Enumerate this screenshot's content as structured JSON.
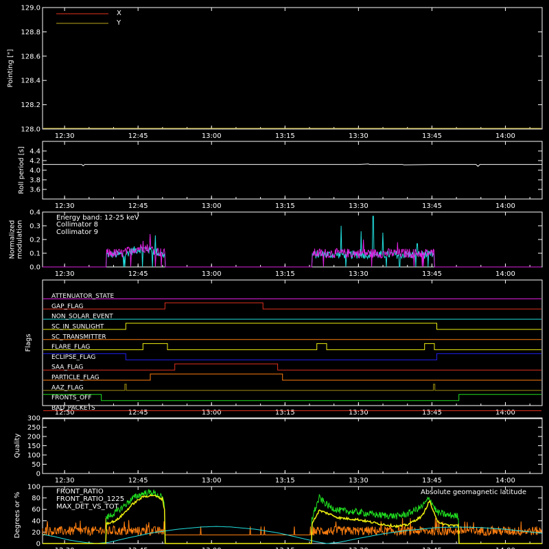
{
  "colors": {
    "background": "#000000",
    "axes": "#ffffff",
    "x": "#e8321e",
    "y": "#bfa81a",
    "white": "#ffffff",
    "cyan": "#22e0e0",
    "magenta": "#e020e0",
    "red": "#e0301e",
    "orange": "#ff7f10",
    "yellow": "#f0f010",
    "blue": "#2020f0",
    "olive": "#a09010",
    "green": "#20e020",
    "lime": "#40ff10"
  },
  "time_axis": {
    "start_min": 745.5,
    "end_min": 847.5,
    "tick_labels": [
      "12:30",
      "12:45",
      "13:00",
      "13:15",
      "13:30",
      "13:45",
      "14:00"
    ],
    "tick_values": [
      750,
      765,
      780,
      795,
      810,
      825,
      840
    ]
  },
  "chart_data": [
    {
      "id": "pointing",
      "type": "line",
      "ylabel": "Pointing [\"]",
      "ylim": [
        128.0,
        129.0
      ],
      "yticks": [
        "128.0",
        "128.2",
        "128.4",
        "128.6",
        "128.8",
        "129.0"
      ],
      "yticks_values": [
        128.0,
        128.2,
        128.4,
        128.6,
        128.8,
        129.0
      ],
      "legend_position": "top-left",
      "series": [
        {
          "name": "X",
          "color": "x",
          "x": [],
          "y": []
        },
        {
          "name": "Y",
          "color": "y",
          "x": [],
          "y": []
        }
      ]
    },
    {
      "id": "roll",
      "type": "line",
      "ylabel": "Roll period [s]",
      "ylim": [
        3.4,
        4.6
      ],
      "yticks": [
        "3.6",
        "3.8",
        "4.0",
        "4.2",
        "4.4"
      ],
      "yticks_values": [
        3.6,
        3.8,
        4.0,
        4.2,
        4.4
      ],
      "series": [
        {
          "color": "white",
          "x": [
            745.5,
            753.5,
            753.8,
            754.1,
            760,
            770,
            780,
            790,
            800,
            810,
            812,
            812.3,
            819,
            819.3,
            825,
            825.3,
            834,
            834.4,
            834.8,
            847.5
          ],
          "y": [
            4.12,
            4.12,
            4.09,
            4.12,
            4.12,
            4.12,
            4.12,
            4.12,
            4.12,
            4.12,
            4.13,
            4.12,
            4.12,
            4.11,
            4.12,
            4.12,
            4.12,
            4.08,
            4.12,
            4.12
          ]
        }
      ]
    },
    {
      "id": "modulation",
      "type": "line",
      "ylabel": [
        "Normalized",
        "modulation"
      ],
      "ylim": [
        0.0,
        0.4
      ],
      "yticks": [
        "0.0",
        "0.1",
        "0.2",
        "0.3",
        "0.4"
      ],
      "yticks_values": [
        0.0,
        0.1,
        0.2,
        0.3,
        0.4
      ],
      "annotation": "Energy band: 12-25 keV",
      "legend_position": "top-left",
      "active_intervals": [
        [
          758.5,
          770.5
        ],
        [
          800.5,
          825.5
        ]
      ],
      "series": [
        {
          "name": "Collimator 8",
          "color": "cyan",
          "baseline": 0.09,
          "spread": 0.03,
          "peaks": [
            [
              813,
              0.37
            ],
            [
              810.5,
              0.26
            ],
            [
              806.5,
              0.3
            ],
            [
              815,
              0.25
            ],
            [
              768.5,
              0.23
            ],
            [
              822,
              0.17
            ]
          ]
        },
        {
          "name": "Collimator 9",
          "color": "magenta",
          "baseline": 0.1,
          "spread": 0.035,
          "peaks": [
            [
              767.5,
              0.24
            ],
            [
              766,
              0.19
            ],
            [
              811,
              0.2
            ],
            [
              818,
              0.18
            ]
          ]
        }
      ]
    },
    {
      "id": "flags",
      "type": "line",
      "ylabel": "Flags",
      "flags": [
        {
          "name": "ATTENUATOR_STATE",
          "color": "magenta",
          "transitions": []
        },
        {
          "name": "GAP_FLAG",
          "color": "red",
          "transitions": [
            [
              770.5,
              1
            ],
            [
              790.5,
              0
            ]
          ]
        },
        {
          "name": "NON_SOLAR_EVENT",
          "color": "cyan",
          "transitions": []
        },
        {
          "name": "SC_IN_SUNLIGHT",
          "color": "yellow",
          "transitions": [
            [
              762.5,
              1
            ],
            [
              826,
              0
            ]
          ]
        },
        {
          "name": "SC_TRANSMITTER",
          "color": "orange",
          "transitions": []
        },
        {
          "name": "FLARE_FLAG",
          "color": "yellow",
          "transitions": [
            [
              766,
              1
            ],
            [
              771,
              0
            ],
            [
              801.5,
              1
            ],
            [
              803.5,
              0
            ],
            [
              823.5,
              1
            ],
            [
              825.5,
              0
            ]
          ]
        },
        {
          "name": "ECLIPSE_FLAG",
          "color": "blue",
          "transitions": [
            [
              762.5,
              0
            ],
            [
              826,
              1
            ]
          ]
        },
        {
          "name": "SAA_FLAG",
          "color": "red",
          "transitions": [
            [
              772.5,
              1
            ],
            [
              793.5,
              0
            ]
          ]
        },
        {
          "name": "PARTICLE_FLAG",
          "color": "orange",
          "transitions": [
            [
              767.5,
              1
            ],
            [
              794.5,
              0
            ]
          ]
        },
        {
          "name": "AAZ_FLAG",
          "color": "olive",
          "transitions": [
            [
              762.3,
              1
            ],
            [
              762.6,
              0
            ],
            [
              825.3,
              1
            ],
            [
              825.6,
              0
            ]
          ]
        },
        {
          "name": "FRONTS_OFF",
          "color": "green",
          "transitions": [
            [
              757.5,
              0
            ],
            [
              830.5,
              1
            ]
          ]
        },
        {
          "name": "BAD_PACKETS",
          "color": "red",
          "transitions": []
        }
      ],
      "initial_states": [
        0,
        0,
        0,
        0,
        0,
        0,
        1,
        0,
        0,
        0,
        1,
        0
      ]
    },
    {
      "id": "quality",
      "type": "line",
      "ylabel": "Quality",
      "ylim": [
        0,
        300
      ],
      "yticks": [
        "0",
        "50",
        "100",
        "150",
        "200",
        "250",
        "300"
      ],
      "yticks_values": [
        0,
        50,
        100,
        150,
        200,
        250,
        300
      ],
      "series": [
        {
          "color": "white",
          "x": [
            745.5,
            847.5
          ],
          "y": [
            300,
            300
          ]
        }
      ]
    },
    {
      "id": "ratio",
      "type": "line",
      "ylabel": "Degrees or %",
      "ylim": [
        0,
        100
      ],
      "yticks": [
        "0",
        "20",
        "40",
        "60",
        "80",
        "100"
      ],
      "yticks_values": [
        0,
        20,
        40,
        60,
        80,
        100
      ],
      "annotation": "Absolute geomagnetic latitude",
      "annotation_color": "cyan",
      "legend_position": "top-left",
      "active_intervals": [
        [
          758.5,
          770.5
        ],
        [
          800.5,
          830.5
        ]
      ],
      "series": [
        {
          "name": "FRONT_RATIO",
          "color": "yellow",
          "profile": [
            [
              758.5,
              35
            ],
            [
              760.5,
              40
            ],
            [
              762,
              52
            ],
            [
              764,
              70
            ],
            [
              766,
              82
            ],
            [
              768,
              85
            ],
            [
              770,
              78
            ],
            [
              770.5,
              55
            ],
            [
              800.5,
              35
            ],
            [
              802,
              58
            ],
            [
              804,
              52
            ],
            [
              806,
              45
            ],
            [
              810,
              42
            ],
            [
              814,
              35
            ],
            [
              818,
              30
            ],
            [
              820,
              33
            ],
            [
              823,
              48
            ],
            [
              824.5,
              75
            ],
            [
              826,
              40
            ],
            [
              828,
              32
            ],
            [
              830.5,
              32
            ]
          ]
        },
        {
          "name": "FRONT_RATIO_1225",
          "color": "green",
          "spread": 12,
          "profile": [
            [
              758.5,
              45
            ],
            [
              760.5,
              55
            ],
            [
              762,
              65
            ],
            [
              764,
              80
            ],
            [
              766,
              88
            ],
            [
              768,
              90
            ],
            [
              770,
              80
            ],
            [
              770.5,
              60
            ],
            [
              800.5,
              45
            ],
            [
              802,
              80
            ],
            [
              804,
              65
            ],
            [
              806,
              58
            ],
            [
              810,
              55
            ],
            [
              814,
              50
            ],
            [
              818,
              48
            ],
            [
              820,
              52
            ],
            [
              823,
              65
            ],
            [
              824.5,
              80
            ],
            [
              826,
              55
            ],
            [
              828,
              50
            ],
            [
              830.5,
              48
            ]
          ]
        },
        {
          "name": "MAX_DET_VS_TOT",
          "color": "orange",
          "baseline": 22,
          "spread": 8
        },
        {
          "name": "Absolute geomagnetic latitude",
          "color": "cyan",
          "profile": [
            [
              745.5,
              16
            ],
            [
              748,
              12
            ],
            [
              751,
              6
            ],
            [
              754,
              2
            ],
            [
              756.5,
              0
            ],
            [
              759,
              2
            ],
            [
              763,
              10
            ],
            [
              768,
              19
            ],
            [
              773,
              25
            ],
            [
              778,
              29
            ],
            [
              781,
              30
            ],
            [
              784,
              29
            ],
            [
              789,
              25
            ],
            [
              794,
              18
            ],
            [
              798,
              10
            ],
            [
              801.5,
              3
            ],
            [
              803.5,
              0
            ],
            [
              806,
              2
            ],
            [
              810,
              9
            ],
            [
              815,
              17
            ],
            [
              820,
              23
            ],
            [
              826,
              28
            ],
            [
              830,
              29
            ],
            [
              835,
              28
            ],
            [
              840,
              25
            ],
            [
              847.5,
              18
            ]
          ]
        }
      ]
    }
  ]
}
